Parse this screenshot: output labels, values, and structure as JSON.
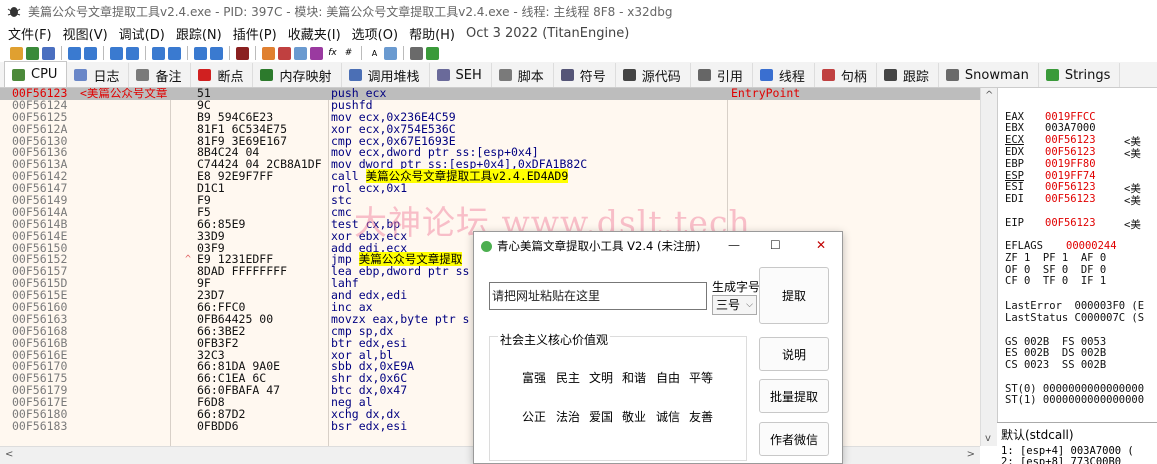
{
  "window": {
    "title": "美篇公众号文章提取工具v2.4.exe - PID: 397C - 模块: 美篇公众号文章提取工具v2.4.exe - 线程: 主线程 8F8 - x32dbg"
  },
  "menu": [
    "文件(F)",
    "视图(V)",
    "调试(D)",
    "跟踪(N)",
    "插件(P)",
    "收藏夹(I)",
    "选项(O)",
    "帮助(H)",
    "Oct 3 2022 (TitanEngine)"
  ],
  "tabs": [
    {
      "label": "CPU",
      "icon": "cpu-icon",
      "color": "#4c8a3a"
    },
    {
      "label": "日志",
      "icon": "log-icon",
      "color": "#6a87c8"
    },
    {
      "label": "备注",
      "icon": "notes-icon",
      "color": "#7a7a7a"
    },
    {
      "label": "断点",
      "icon": "breakpoint-icon",
      "color": "#d02020"
    },
    {
      "label": "内存映射",
      "icon": "memory-map-icon",
      "color": "#2c7a2c"
    },
    {
      "label": "调用堆栈",
      "icon": "call-stack-icon",
      "color": "#4b6fb5"
    },
    {
      "label": "SEH",
      "icon": "seh-icon",
      "color": "#6a6a9a"
    },
    {
      "label": "脚本",
      "icon": "script-icon",
      "color": "#7a7a7a"
    },
    {
      "label": "符号",
      "icon": "symbols-icon",
      "color": "#555577"
    },
    {
      "label": "源代码",
      "icon": "source-icon",
      "color": "#444444"
    },
    {
      "label": "引用",
      "icon": "references-icon",
      "color": "#666666"
    },
    {
      "label": "线程",
      "icon": "threads-icon",
      "color": "#3a6fd0"
    },
    {
      "label": "句柄",
      "icon": "handles-icon",
      "color": "#c04040"
    },
    {
      "label": "跟踪",
      "icon": "trace-icon",
      "color": "#444444"
    },
    {
      "label": "Snowman",
      "icon": "snowman-icon",
      "color": "#6a6a6a"
    },
    {
      "label": "Strings",
      "icon": "strings-icon",
      "color": "#3a9a3a"
    }
  ],
  "disasm": [
    {
      "addr": "00F56123",
      "label": "<美篇公众号文章",
      "bytes": "51",
      "ins": "push ecx",
      "comment": "EntryPoint",
      "current": true
    },
    {
      "addr": "00F56124",
      "bytes": "9C",
      "ins": "pushfd"
    },
    {
      "addr": "00F56125",
      "bytes": "B9 594C6E23",
      "ins": "mov ecx,0x236E4C59"
    },
    {
      "addr": "00F5612A",
      "bytes": "81F1 6C534E75",
      "ins": "xor ecx,0x754E536C"
    },
    {
      "addr": "00F56130",
      "bytes": "81F9 3E69E167",
      "ins": "cmp ecx,0x67E1693E"
    },
    {
      "addr": "00F56136",
      "bytes": "8B4C24 04",
      "ins": "mov ecx,dword ptr ss:[esp+0x4]"
    },
    {
      "addr": "00F5613A",
      "bytes": "C74424 04 2CB8A1DF",
      "ins": "mov dword ptr ss:[esp+0x4],0xDFA1B82C"
    },
    {
      "addr": "00F56142",
      "bytes": "E8 92E9F7FF",
      "ins_pre": "call ",
      "ins_hl": "美篇公众号文章提取工具v2.4.ED4AD9",
      "hl": true
    },
    {
      "addr": "00F56147",
      "bytes": "D1C1",
      "ins": "rol ecx,0x1"
    },
    {
      "addr": "00F56149",
      "bytes": "F9",
      "ins": "stc"
    },
    {
      "addr": "00F5614A",
      "bytes": "F5",
      "ins": "cmc"
    },
    {
      "addr": "00F5614B",
      "bytes": "66:85E9",
      "ins": "test cx,bp"
    },
    {
      "addr": "00F5614E",
      "bytes": "33D9",
      "ins": "xor ebx,ecx"
    },
    {
      "addr": "00F56150",
      "bytes": "03F9",
      "ins": "add edi,ecx"
    },
    {
      "addr": "00F56152",
      "bytes": "E9 1231EDFF",
      "ins_pre": "jmp ",
      "ins_hl": "美篇公众号文章提取",
      "hl": true,
      "mark": "^"
    },
    {
      "addr": "00F56157",
      "bytes": "8DAD FFFFFFFF",
      "ins": "lea ebp,dword ptr ss"
    },
    {
      "addr": "00F5615D",
      "bytes": "9F",
      "ins": "lahf"
    },
    {
      "addr": "00F5615E",
      "bytes": "23D7",
      "ins": "and edx,edi"
    },
    {
      "addr": "00F56160",
      "bytes": "66:FFC0",
      "ins": "inc ax"
    },
    {
      "addr": "00F56163",
      "bytes": "0FB64425 00",
      "ins": "movzx eax,byte ptr s"
    },
    {
      "addr": "00F56168",
      "bytes": "66:3BE2",
      "ins": "cmp sp,dx"
    },
    {
      "addr": "00F5616B",
      "bytes": "0FB3F2",
      "ins": "btr edx,esi"
    },
    {
      "addr": "00F5616E",
      "bytes": "32C3",
      "ins": "xor al,bl"
    },
    {
      "addr": "00F56170",
      "bytes": "66:81DA 9A0E",
      "ins": "sbb dx,0xE9A"
    },
    {
      "addr": "00F56175",
      "bytes": "66:C1EA 6C",
      "ins": "shr dx,0x6C"
    },
    {
      "addr": "00F56179",
      "bytes": "66:0FBAFA 47",
      "ins": "btc dx,0x47"
    },
    {
      "addr": "00F5617E",
      "bytes": "F6D8",
      "ins": "neg al"
    },
    {
      "addr": "00F56180",
      "bytes": "66:87D2",
      "ins": "xchg dx,dx"
    },
    {
      "addr": "00F56183",
      "bytes": "0FBDD6",
      "ins": "bsr edx,esi"
    }
  ],
  "watermark": "大神论坛 www.dslt.tech",
  "registers": [
    {
      "name": "EAX",
      "value": "0019FFCC",
      "extra": ""
    },
    {
      "name": "EBX",
      "value": "003A7000",
      "extra": "",
      "plain": true
    },
    {
      "name": "ECX",
      "value": "00F56123",
      "extra": "<美",
      "ul": true
    },
    {
      "name": "EDX",
      "value": "00F56123",
      "extra": "<美"
    },
    {
      "name": "EBP",
      "value": "0019FF80",
      "extra": ""
    },
    {
      "name": "ESP",
      "value": "0019FF74",
      "extra": "",
      "ul": true
    },
    {
      "name": "ESI",
      "value": "00F56123",
      "extra": "<美"
    },
    {
      "name": "EDI",
      "value": "00F56123",
      "extra": "<美"
    },
    {
      "name": "EIP",
      "value": "00F56123",
      "extra": "<美"
    }
  ],
  "eflags": {
    "label": "EFLAGS",
    "value": "00000244",
    "line1": "ZF 1  PF 1  AF 0",
    "line2": "OF 0  SF 0  DF 0",
    "line3": "CF 0  TF 0  IF 1"
  },
  "lasterror": {
    "error": "LastError  000003F0 (E",
    "status": "LastStatus C000007C (S"
  },
  "segments": [
    "GS 002B  FS 0053",
    "ES 002B  DS 002B",
    "CS 0023  SS 002B"
  ],
  "st": [
    "ST(0) 0000000000000000",
    "ST(1) 0000000000000000"
  ],
  "stack": {
    "header": "默认(stdcall)",
    "l1": "1: [esp+4] 003A7000 (",
    "l2": "2: [esp+8] 773C00B0"
  },
  "popup": {
    "title": "青心美篇文章提取小工具 V2.4 (未注册)",
    "url_placeholder": "请把网址粘贴在这里",
    "font_label": "生成字号",
    "font_value": "三号",
    "btn_extract": "提取",
    "btn_help": "说明",
    "btn_batch": "批量提取",
    "btn_wechat": "作者微信",
    "group_title": "社会主义核心价值观",
    "values_row1": [
      "富强",
      "民主",
      "文明",
      "和谐",
      "自由",
      "平等"
    ],
    "values_row2": [
      "公正",
      "法治",
      "爱国",
      "敬业",
      "诚信",
      "友善"
    ]
  }
}
